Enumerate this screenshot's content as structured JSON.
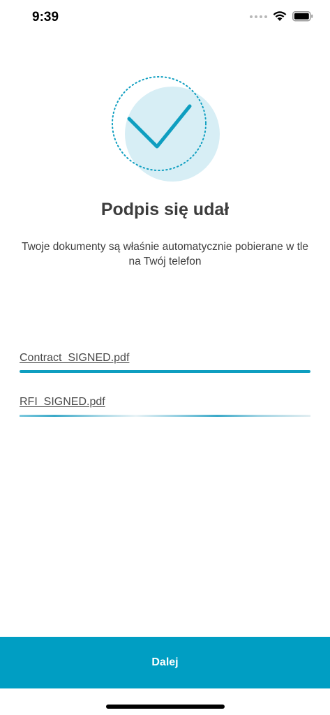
{
  "status_bar": {
    "time": "9:39"
  },
  "main": {
    "title": "Podpis się udał",
    "subtitle": "Twoje dokumenty są właśnie automatycznie pobierane w tle na Twój telefon"
  },
  "files": [
    {
      "name": "Contract_SIGNED.pdf",
      "progress": 1.0,
      "state": "complete"
    },
    {
      "name": "RFI_SIGNED.pdf",
      "state": "downloading"
    }
  ],
  "footer": {
    "next_label": "Dalej"
  },
  "colors": {
    "accent": "#009ec3",
    "check_stroke": "#0e9ec0",
    "circle_fill": "#d7eef5"
  }
}
